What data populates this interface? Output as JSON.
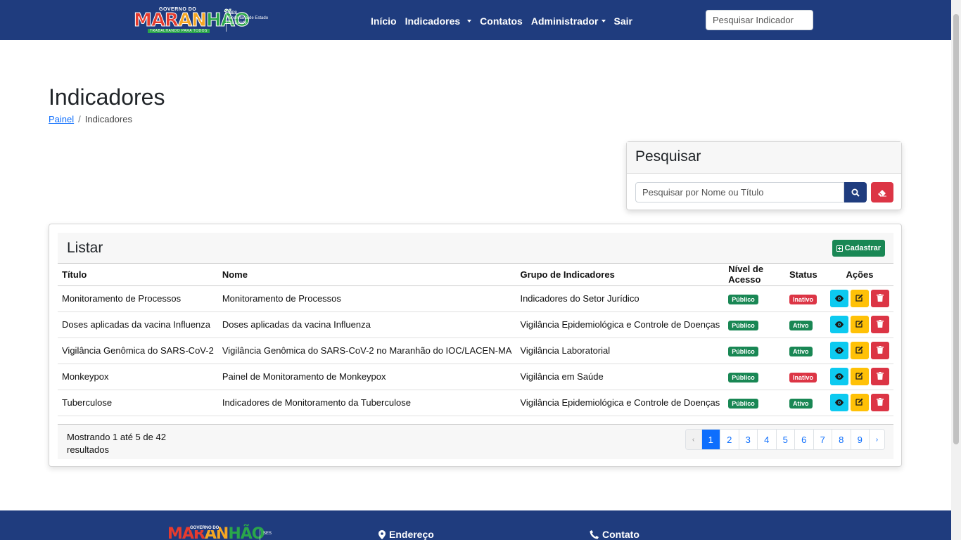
{
  "header": {
    "logo": {
      "top": "GOVERNO DO",
      "name": "MARANHÃO",
      "tagline": "TRABALHANDO PARA TODOS",
      "ses_short": "SES",
      "ses_line1": "Secretaria de Estado",
      "ses_line2": "da Saúde"
    },
    "nav": {
      "inicio": "Início",
      "indicadores": "Indicadores",
      "contatos": "Contatos",
      "administrador": "Administrador",
      "sair": "Sair"
    },
    "search_placeholder": "Pesquisar Indicador"
  },
  "page": {
    "title": "Indicadores",
    "breadcrumb": {
      "home": "Painel",
      "separator": "/",
      "current": "Indicadores"
    }
  },
  "search_card": {
    "title": "Pesquisar",
    "placeholder": "Pesquisar por Nome ou Título"
  },
  "list": {
    "title": "Listar",
    "add_button": "Cadastrar",
    "columns": [
      "Título",
      "Nome",
      "Grupo de Indicadores",
      "Nível de Acesso",
      "Status",
      "Ações"
    ],
    "rows": [
      {
        "titulo": "Monitoramento de Processos",
        "nome": "Monitoramento de Processos",
        "grupo": "Indicadores do Setor Jurídico",
        "acesso": "Público",
        "status": "Inativo"
      },
      {
        "titulo": "Doses aplicadas da vacina Influenza",
        "nome": "Doses aplicadas da vacina Influenza",
        "grupo": "Vigilância Epidemiológica e Controle de Doenças",
        "acesso": "Público",
        "status": "Ativo"
      },
      {
        "titulo": "Vigilância Genômica do SARS-CoV-2",
        "nome": "Vigilância Genômica do SARS-CoV-2 no Maranhão do IOC/LACEN-MA",
        "grupo": "Vigilância Laboratorial",
        "acesso": "Público",
        "status": "Ativo"
      },
      {
        "titulo": "Monkeypox",
        "nome": "Painel de Monitoramento de Monkeypox",
        "grupo": "Vigilância em Saúde",
        "acesso": "Público",
        "status": "Inativo"
      },
      {
        "titulo": "Tuberculose",
        "nome": "Indicadores de Monitoramento da Tuberculose",
        "grupo": "Vigilância Epidemiológica e Controle de Doenças",
        "acesso": "Público",
        "status": "Ativo"
      }
    ],
    "footer_info": "Mostrando 1 até 5 de 42 resultados",
    "pagination": {
      "prev": "‹",
      "pages": [
        "1",
        "2",
        "3",
        "4",
        "5",
        "6",
        "7",
        "8",
        "9"
      ],
      "current": "1",
      "next": "›"
    }
  },
  "footer": {
    "logo_top": "GOVERNO DO",
    "logo_name": "MARANHÃO",
    "ses_short": "SES",
    "endereco": "Endereço",
    "contato": "Contato"
  },
  "colors": {
    "brand_blue": "#1f3c7e",
    "success": "#198754",
    "danger": "#dc3545",
    "info": "#0dcaf0",
    "warning": "#ffc107",
    "primary": "#0d6efd"
  }
}
